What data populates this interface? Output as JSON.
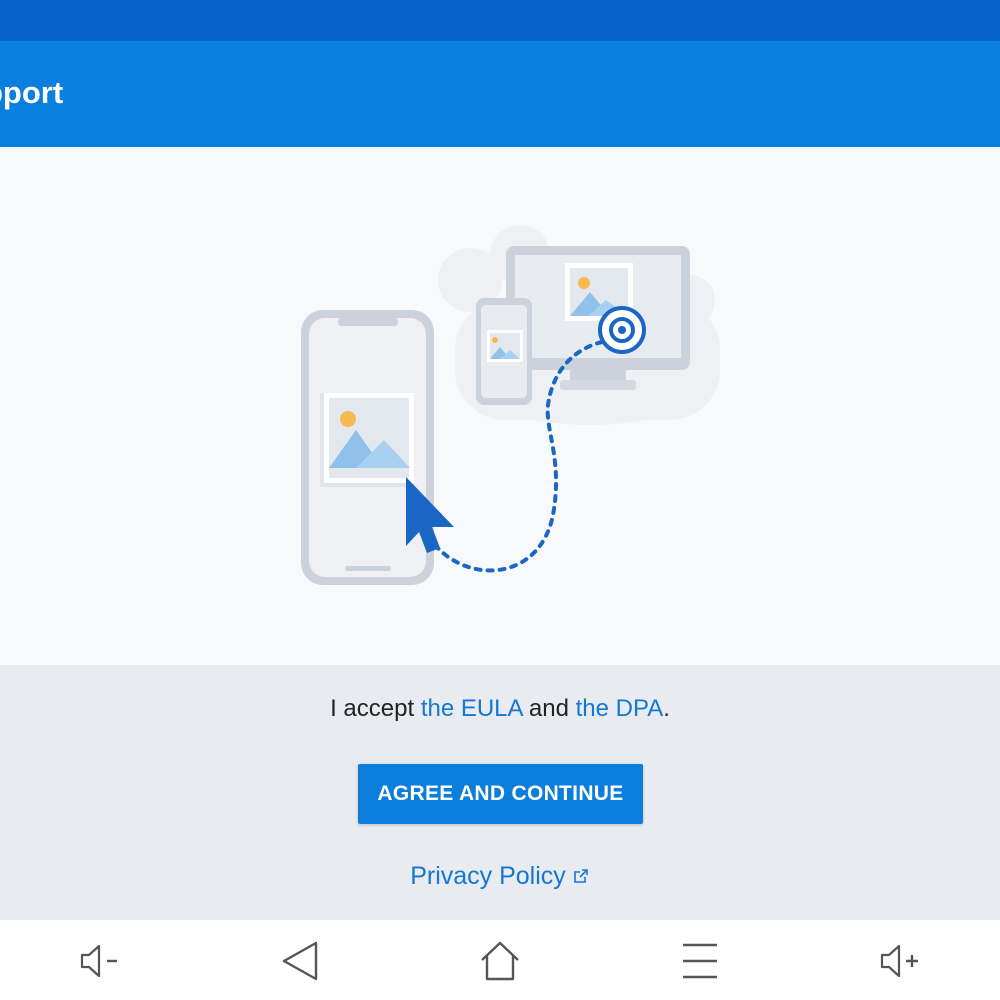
{
  "app_bar": {
    "title": "pport"
  },
  "consent": {
    "prefix": "I accept ",
    "eula_link": "the EULA",
    "middle": " and ",
    "dpa_link": "the DPA",
    "suffix": "."
  },
  "agree_button": {
    "label": "AGREE AND CONTINUE"
  },
  "privacy": {
    "label": "Privacy Policy"
  },
  "nav_bar": {
    "buttons": [
      {
        "icon": "volume-down-icon"
      },
      {
        "icon": "back-icon"
      },
      {
        "icon": "home-icon"
      },
      {
        "icon": "menu-icon"
      },
      {
        "icon": "volume-up-icon"
      }
    ]
  },
  "colors": {
    "status_bar": "#0563c8",
    "app_bar": "#0a7fde",
    "primary_button": "#0b7ddb",
    "link": "#1577d4",
    "consent_bg": "#e8ebf0"
  }
}
